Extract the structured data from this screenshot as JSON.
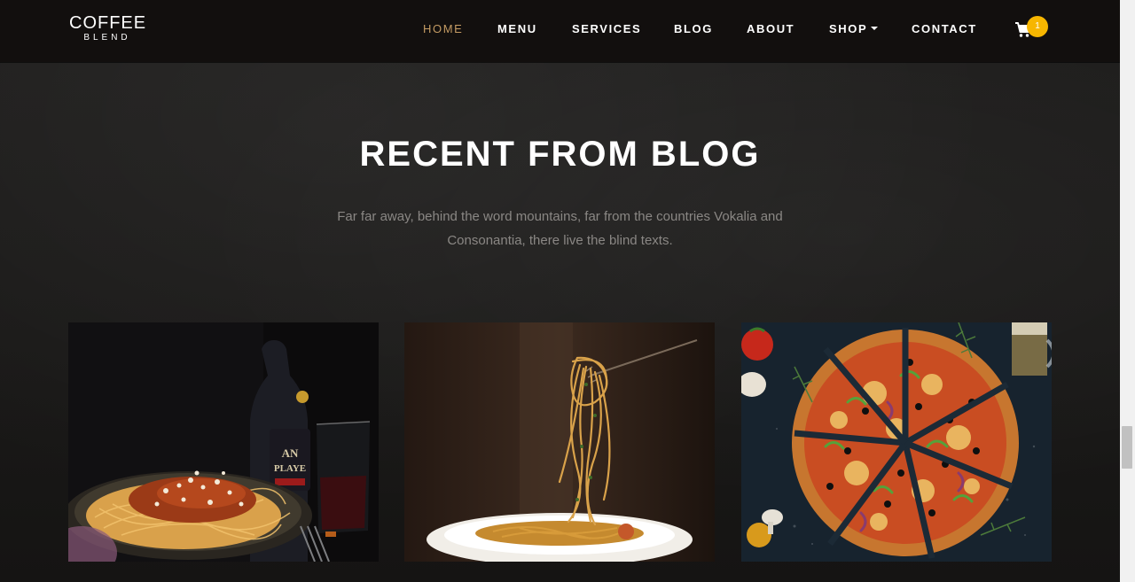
{
  "brand": {
    "line1": "COFFEE",
    "line2": "BLEND"
  },
  "nav": {
    "items": [
      {
        "label": "HOME",
        "active": true
      },
      {
        "label": "MENU"
      },
      {
        "label": "SERVICES"
      },
      {
        "label": "BLOG"
      },
      {
        "label": "ABOUT"
      },
      {
        "label": "SHOP"
      },
      {
        "label": "CONTACT"
      }
    ],
    "cart_count": "1",
    "accent_color": "#c49b63",
    "badge_color": "#f7b600"
  },
  "section": {
    "title": "RECENT FROM BLOG",
    "intro_line1": "Far far away, behind the word mountains, far from the countries Vokalia and",
    "intro_line2": "Consonantia, there live the blind texts."
  },
  "blog_cards": [
    {
      "image": "spaghetti-bolognese-photo"
    },
    {
      "image": "pasta-on-fork-photo"
    },
    {
      "image": "sliced-pizza-photo"
    }
  ]
}
